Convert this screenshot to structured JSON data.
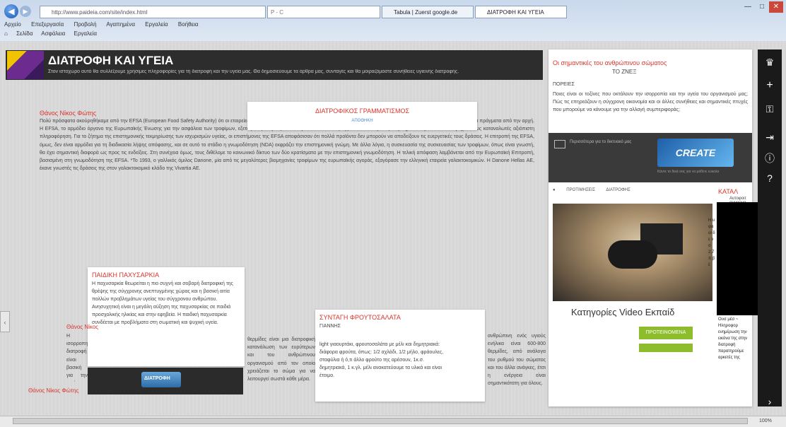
{
  "browser": {
    "address": "http://www.paideia.com/site/index.html",
    "addr_ctl": "P - C",
    "tab1": "Tabula | Zuerst google.de",
    "tab2": "ΔΙΑΤΡΟΦΗ ΚΑΙ ΥΓΕΙΑ",
    "menu": [
      "Αρχείο",
      "Επεξεργασία",
      "Προβολή",
      "Αγαπημένα",
      "Εργαλεία",
      "Βοήθεια"
    ],
    "favbar": [
      "Σελίδα",
      "Ασφάλεια",
      "Εργαλεία"
    ],
    "window_controls": [
      "—",
      "□",
      "✕"
    ],
    "zoom": "100%"
  },
  "header": {
    "title": "ΔΙΑΤΡΟΦΗ ΚΑΙ ΥΓΕΙΑ",
    "subtitle": "Στον ιστοχώρο αυτό θα συλλέξουμε χρήσιμες πληροφορίες για τη διατροφή και την υγεία μας. Θα δημοσιεύουμε τα άρθρα μας, συνταγές και θα μοιραζόμαστε συνήθειες υγιεινής διατροφής."
  },
  "article1": {
    "author": "Θάνος Νίκος Φώτης",
    "body": "Πολύ πρόσφατα ακούρηθήκαμε από την EFSA (European Food Safety Authority) ότι οι εταιρείες τροφίμων θα ρωτήσουν τις φυσικές βελτιώσεις της υγείας ως εργαλεία προώθησης. Αλλά ας κάνουμε τα πράγματα από την αρχή. Η EFSA, το αρμόδιο όργανο της Ευρωπαϊκής Ένωσης για την ασφάλεια των τροφίμων, εξετάζει τις αιτήσεις των εταιρειών. Ο σκοπός της είναι να διαφυλάξει τη δημόσια υγεία και να παρέχει στους καταναλωτές αξιόπιστη πληροφόρηση. Για το ζήτημα της επιστημονικής τεκμηρίωσης των ισχυρισμών υγείας, οι επιστήμονες της EFSA αποφάσισαν ότι πολλά προϊόντα δεν μπορούν να αποδείξουν τις ευεργετικές τους δράσεις. Η επιτροπή της EFSA, όμως, δεν είναι αρμόδια για τη διαδικασία λήψης απόφασης, και σε αυτό το στάδιο η γνωμοδότηση (NDA) εκφράζει την επιστημονική γνώμη. Με άλλα λόγια, η συσκευασία της συσκευασίας των τροφίμων, όπως είναι γνωστή, θα έχει σημαντική διαφορά ως προς τις ενδείξεις. Στη συνέχεια όμως, τους διθέλομε το κοινωνικό δίκτυο των δύο κρατίσματα με την επιστημονική γνωμοδότηση. Η τελική απόφαση λαμβάνεται από την Ευρωπαϊκή Επιτροπή, βασισμένη στη γνωμοδότηση της EFSA. *Το 1993, ο γαλλικός όμιλος Danone, μία από τις μεγαλύτερες βιομηχανίες τροφίμων της ευρωπαϊκής αγοράς, εξαγόρασε την ελληνική εταιρεία γαλακτοκομικών. Η Danone Hellas ΑΕ, έκανε γνωστές τις δράσεις της στον γαλακτοκομικό κλάδο της Vivartia ΑΕ."
  },
  "diatrofikos": {
    "title": "ΔΙΑΤΡΟΦΙΚΟΣ ΓΡΑΜΜΑΤΙΣΜΟΣ",
    "link": "ΑΠΟΘΗΚΗ"
  },
  "paidiki": {
    "title": "ΠΑΙΔΙΚΗ ΠΑΧΥΣΑΡΚΙΑ",
    "body": "Η παχυσαρκία θεωρείται η πιο συχνή και σοβαρή διατροφική της θρέψης της σύγχρονης ανεπτυγμένης χώρας και η βασική αιτία πολλών προβλημάτων υγείας του σύγχρονου ανθρώπου. Ανησυχητική είναι η μεγάλη αύξηση της παχυσαρκίας σε παιδιά προσχολικής ηλικίας και στην εφηβεία. Η παιδική παχυσαρκία συνδέεται με προβλήματα στη σωματική και ψυχική υγεία."
  },
  "video_thumb": {
    "label": "ΔΙΑΤΡΟΦΗ"
  },
  "article2": {
    "author": "Θάνος Νίκος",
    "body": "Η ισορροπημένη διατροφή είναι βασική για την υγεία του οργανισμού και συμβάλλει στη σωστή λειτουργία. Συνεχίζει στη μεγάλη ανάπτυξη."
  },
  "article3": {
    "author": "Θάνος Νίκος Φώτης"
  },
  "midtext": {
    "body": "θερμίδες είναι μια διατροφική κατανάλωση των ευρύτερων και του ανθρώπινου οργανισμού από τον οποίο χρειάζεται το σώμα για να λειτουργεί σωστά κάθε μέρα."
  },
  "syntagi": {
    "title": "ΣΥΝΤΑΓΗ ΦΡΟΥΤΟΣΑΛΑΤΑ",
    "author": "ΓΙΑΝΝΗΣ",
    "body": "light γιαουρτάκι, φρουτοσαλάτα με μέλι και δημητριακά: διάφορα φρούτα, όπως: 1/2 αχλάδι, 1/2 μήλο, φράουλες, σταφύλια ή ό,τι άλλο φρούτο της αρέσουν, 1κ.σ. δημητριακά, 1 κ.γλ. μέλι ανακατεύουμε τα υλικά και είναι έτοιμο."
  },
  "rightfrag": {
    "body": "ανθρώπινη ενός υγιούς ενήλικα είναι 600-800 θερμίδες, από ανάλογα του ρυθμού του σώματος και του άλλα ανάγκες, έτσι η ενέργεια είναι σημαντικότατη για όλους."
  },
  "rightpanel": {
    "title": "Οι σημαντικές του ανθρώπινου σώματος",
    "subtitle": "ΤΟ ΖΝΕΞ",
    "label": "ΠΟΡΕΙΕΣ",
    "body": "Ποιες είναι οι τοξίνες που οκτάλουν την ισορροπία και την υγεία του οργανισμού μας; Πώς τις επηρεάζουν η σύγχρονη οικονομία και οι άλλες συνήθειες και σημαντικές πτυχές που μπορούμε να κάνουμε για την αλλαγή συμπεριφοράς;"
  },
  "dark_ad": {
    "small": "Περισσότερα για το δικτυακό μας",
    "create": "CREATE",
    "caption": "Κάντε τα δικά σας για να μάθετε εύκολα"
  },
  "tabs_row": [
    "ΠΡΟΤΙΜΗΣΕΙΣ",
    "ΔΙΑΤΡΟΦΗΣ"
  ],
  "video": {
    "category_label": "Κατηγορίες Video Εκπαίδ",
    "button": "ΠΡΟΤΕΙΝΟΜΕΝΑ"
  },
  "katal": {
    "label": "ΚΑΤΑΛ",
    "text": "Αυτοφοιτ συναργα"
  },
  "strip": {
    "body": "Ουσ μέσ ~ Ηληροφορ ενημέρωση την εικόνα της στην διατροφή παρατηρούμε αρκετές της"
  },
  "rsmall": {
    "body": "Η υ φα οι δ ε ν σ 2,7 π β έ"
  },
  "toolbar_icons": [
    "crown-icon",
    "plus-icon",
    "key-icon",
    "login-icon",
    "info-icon",
    "help-icon",
    "next-icon"
  ],
  "colors": {
    "accent": "#d9342b",
    "link": "#4a8ad4",
    "button_green": "#8dbd2c",
    "header_bg": "#2d2d2d",
    "toolbar_bg": "#1a1a1a"
  }
}
